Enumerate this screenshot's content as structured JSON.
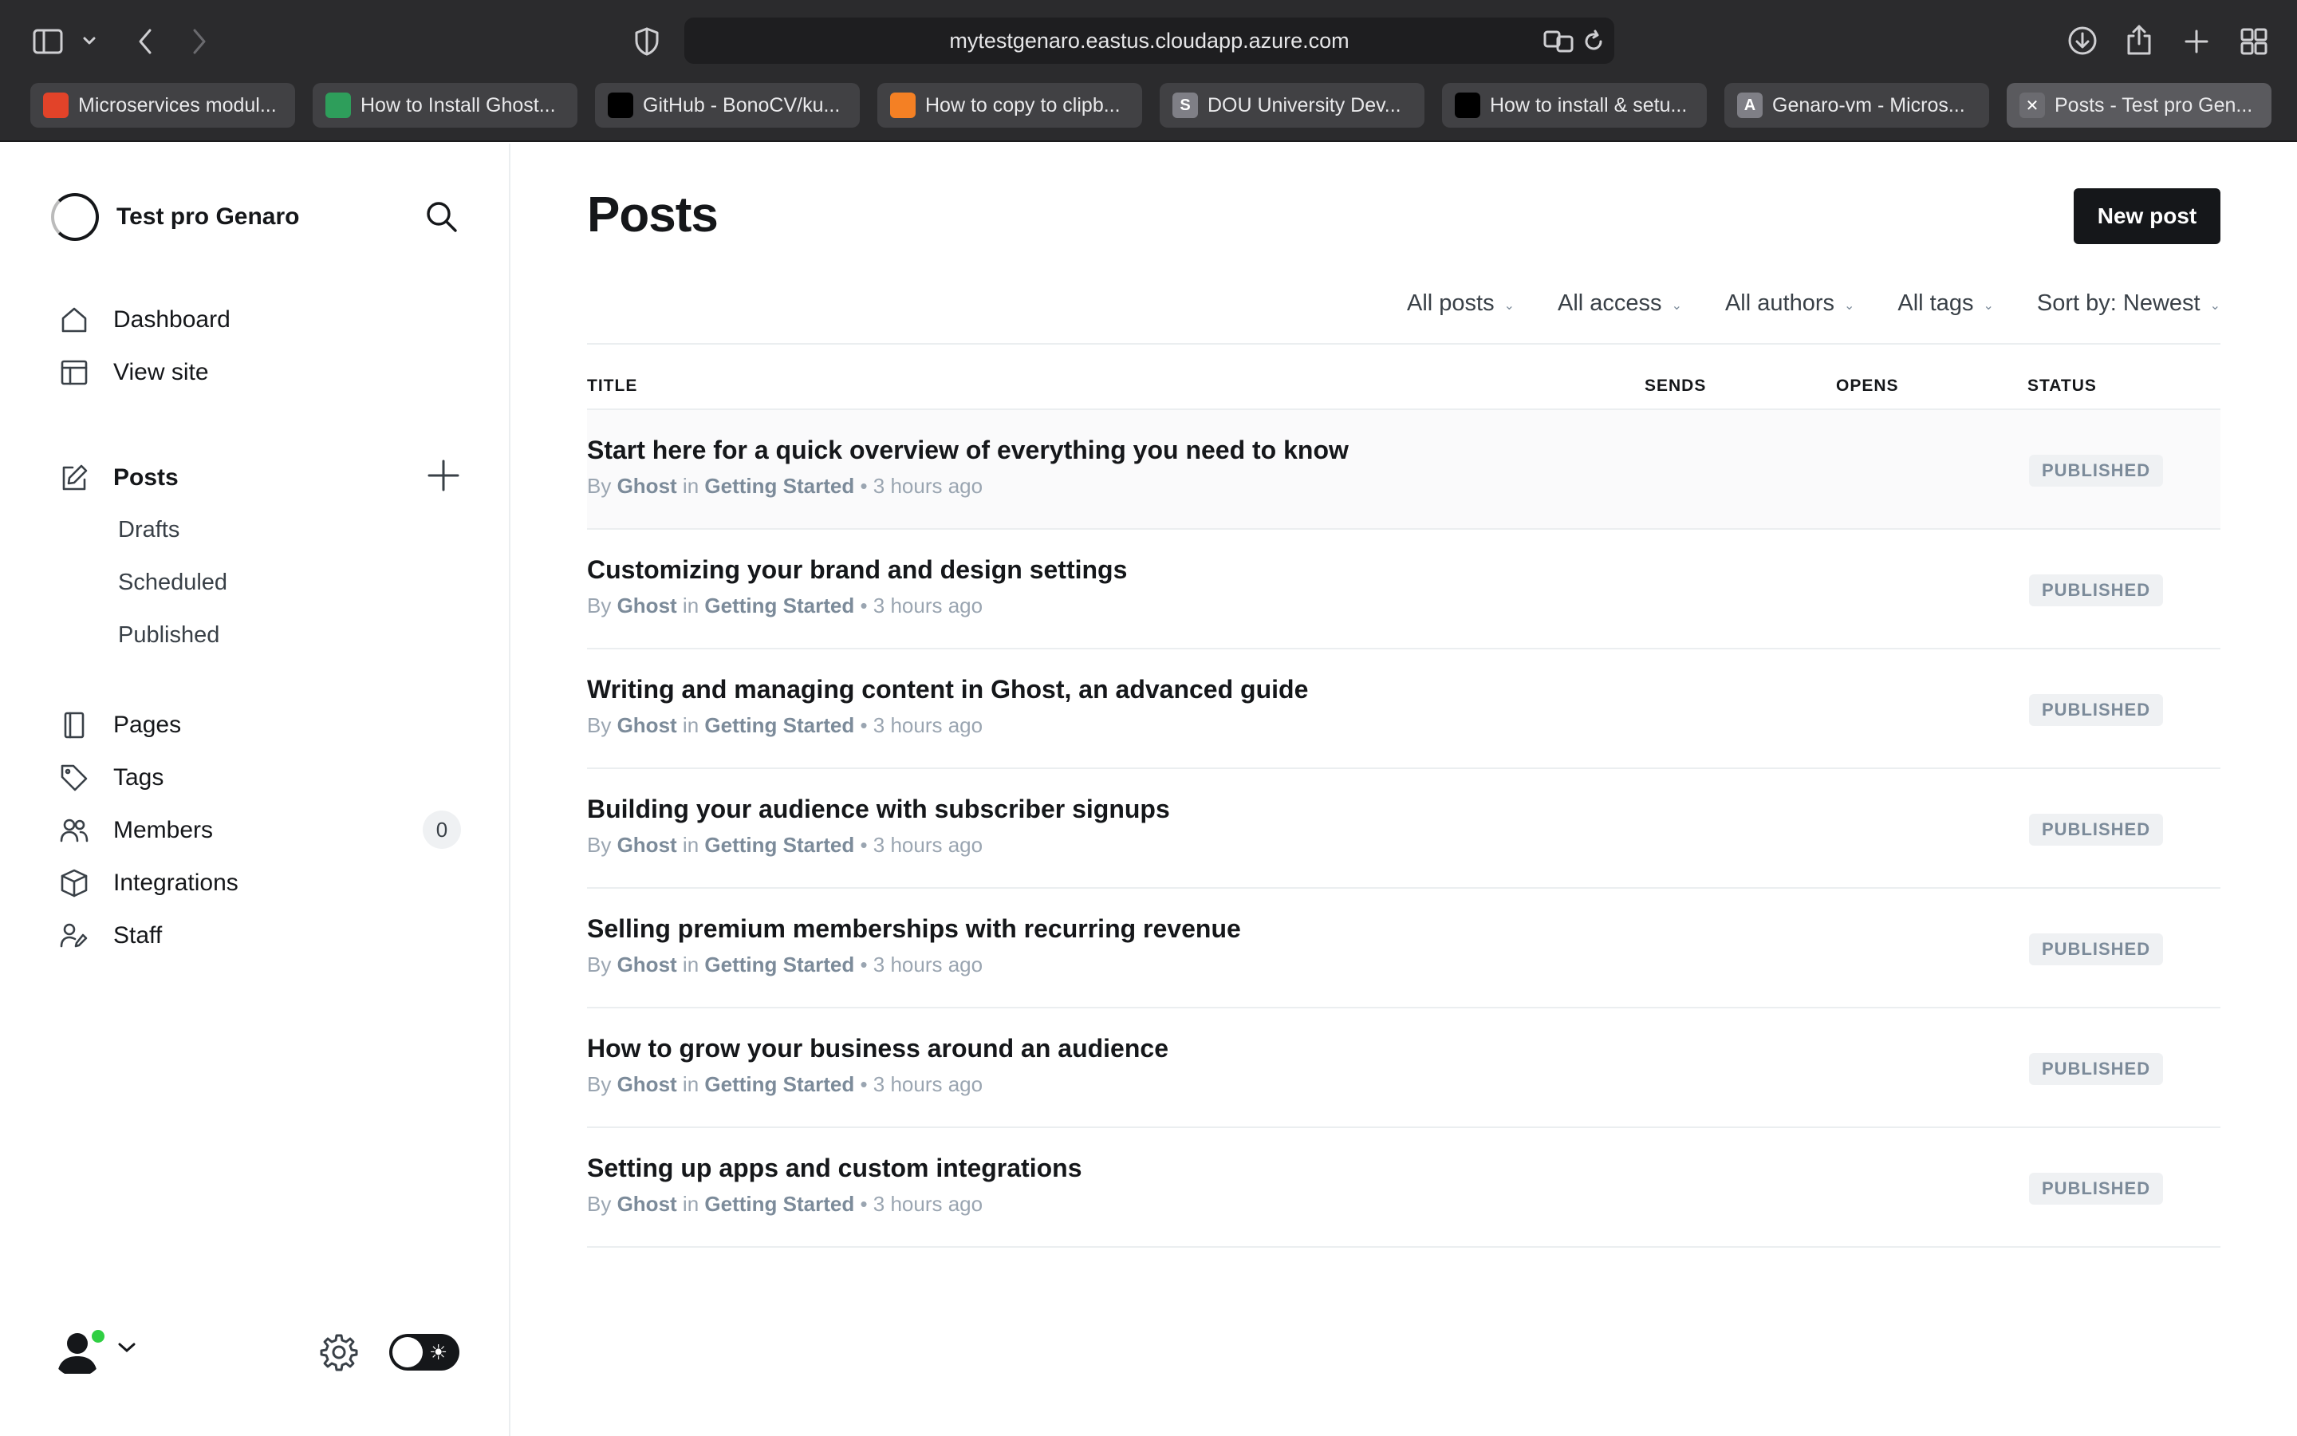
{
  "browser": {
    "url": "mytestgenaro.eastus.cloudapp.azure.com",
    "tabs": [
      {
        "label": "Microservices modul...",
        "icon": "gitlab-icon",
        "color": "#e24329",
        "glyph": ""
      },
      {
        "label": "How to Install Ghost...",
        "icon": "leaf-icon",
        "color": "#2e9e5b",
        "glyph": ""
      },
      {
        "label": "GitHub - BonoCV/ku...",
        "icon": "github-icon",
        "color": "#000000",
        "glyph": ""
      },
      {
        "label": "How to copy to clipb...",
        "icon": "stackoverflow-icon",
        "color": "#f48024",
        "glyph": ""
      },
      {
        "label": "DOU University Dev...",
        "icon": "dou-icon",
        "color": "#7f7f86",
        "glyph": "S"
      },
      {
        "label": "How to install & setu...",
        "icon": "ghost-ring-icon",
        "color": "#000000",
        "glyph": ""
      },
      {
        "label": "Genaro-vm - Micros...",
        "icon": "azure-icon",
        "color": "#7f7f86",
        "glyph": "A"
      },
      {
        "label": "Posts - Test pro Gen...",
        "icon": "ghost-icon",
        "color": "#6b6b70",
        "glyph": "✕"
      }
    ]
  },
  "sidebar": {
    "site_title": "Test pro Genaro",
    "nav_primary": [
      {
        "label": "Dashboard",
        "icon": "home-icon"
      },
      {
        "label": "View site",
        "icon": "layout-icon"
      }
    ],
    "posts": {
      "label": "Posts",
      "icon": "edit-icon"
    },
    "posts_sub": [
      "Drafts",
      "Scheduled",
      "Published"
    ],
    "nav_secondary": [
      {
        "label": "Pages",
        "icon": "page-icon"
      },
      {
        "label": "Tags",
        "icon": "tag-icon"
      },
      {
        "label": "Members",
        "icon": "members-icon"
      },
      {
        "label": "Integrations",
        "icon": "box-icon"
      },
      {
        "label": "Staff",
        "icon": "staff-icon"
      }
    ],
    "members_count": "0"
  },
  "main": {
    "title": "Posts",
    "new_post_label": "New post",
    "filters": [
      "All posts",
      "All access",
      "All authors",
      "All tags",
      "Sort by: Newest"
    ],
    "columns": {
      "title": "TITLE",
      "sends": "SENDS",
      "opens": "OPENS",
      "status": "STATUS"
    },
    "meta": {
      "by": "By",
      "author": "Ghost",
      "in": "in",
      "tag": "Getting Started",
      "time": "3 hours ago"
    },
    "posts": [
      {
        "title": "Start here for a quick overview of everything you need to know",
        "status": "PUBLISHED"
      },
      {
        "title": "Customizing your brand and design settings",
        "status": "PUBLISHED"
      },
      {
        "title": "Writing and managing content in Ghost, an advanced guide",
        "status": "PUBLISHED"
      },
      {
        "title": "Building your audience with subscriber signups",
        "status": "PUBLISHED"
      },
      {
        "title": "Selling premium memberships with recurring revenue",
        "status": "PUBLISHED"
      },
      {
        "title": "How to grow your business around an audience",
        "status": "PUBLISHED"
      },
      {
        "title": "Setting up apps and custom integrations",
        "status": "PUBLISHED"
      }
    ]
  }
}
